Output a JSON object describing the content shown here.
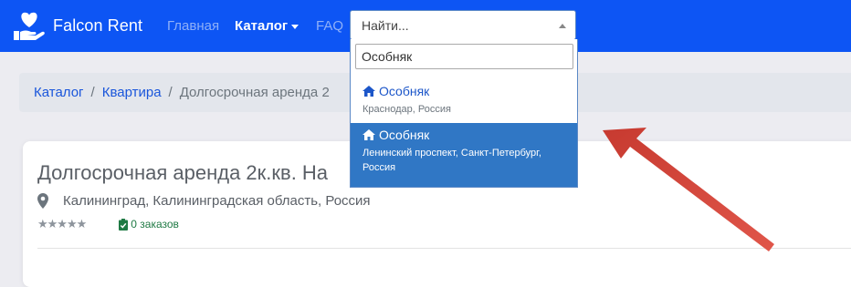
{
  "navbar": {
    "brand": "Falcon Rent",
    "links": [
      "Главная",
      "Каталог",
      "FAQ"
    ]
  },
  "select": {
    "current": "Найти...",
    "search_value": "Особняк",
    "results": [
      {
        "title": "Особняк",
        "subtitle": "Краснодар, Россия",
        "highlighted": false
      },
      {
        "title": "Особняк",
        "subtitle": "Ленинский проспект, Санкт-Петербург, Россия",
        "highlighted": true
      }
    ]
  },
  "breadcrumb": {
    "items": [
      "Каталог",
      "Квартира",
      "Долгосрочная аренда 2"
    ]
  },
  "listing": {
    "title": "Долгосрочная аренда 2к.кв. На",
    "location": "Калининград, Калининградская область, Россия",
    "stars": "★★★★★",
    "orders": "0 заказов"
  },
  "colors": {
    "navbar": "#0d55f4",
    "accent": "#1a56db",
    "highlight": "#3077c5",
    "annotation_arrow": "#d9493e"
  },
  "icons": [
    "heart-hand-icon",
    "map-pin-icon",
    "star-icon",
    "clipboard-check-icon",
    "home-icon",
    "chevron-down-icon"
  ]
}
